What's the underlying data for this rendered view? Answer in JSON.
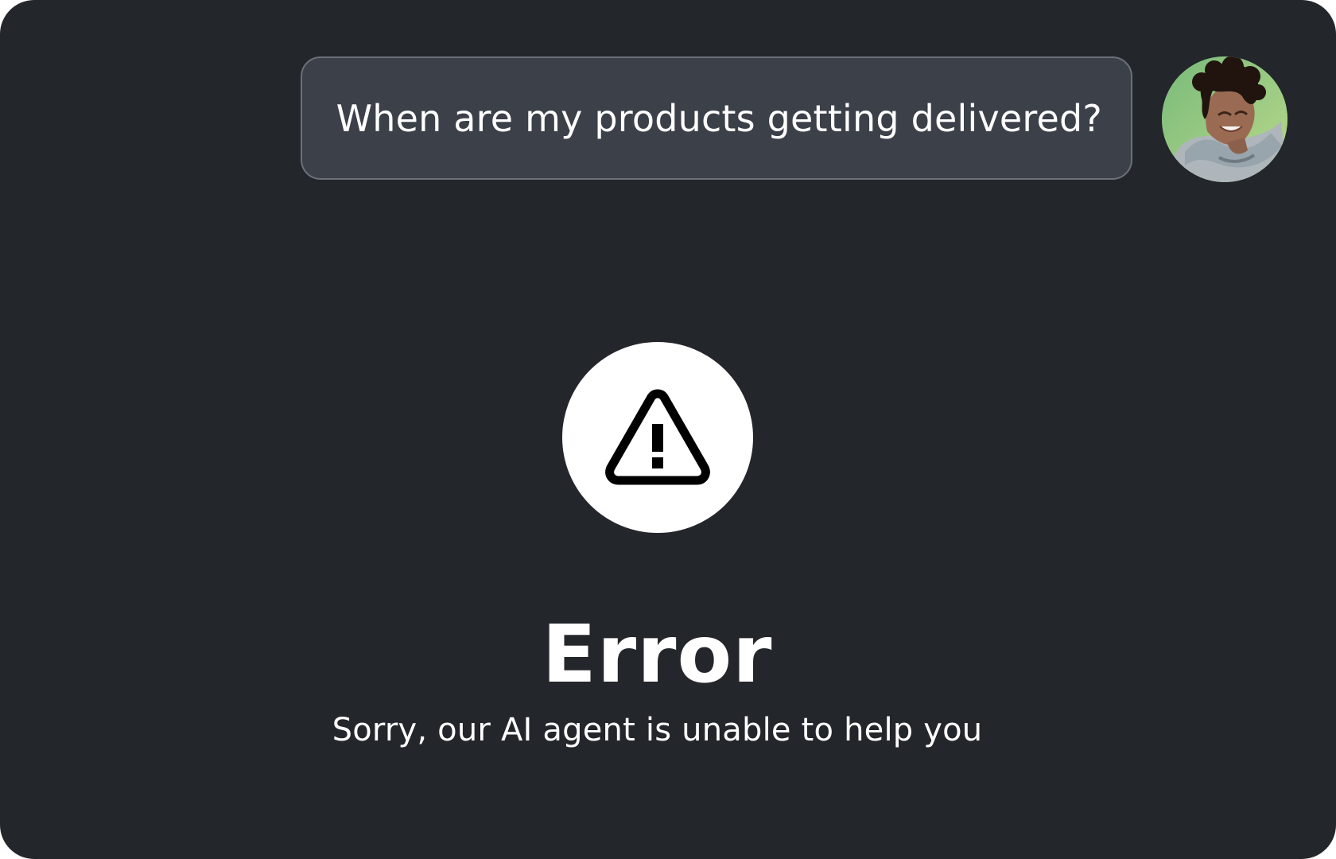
{
  "chat": {
    "user_message": "When are my products getting delivered?",
    "avatar_icon": "user-avatar-icon"
  },
  "error": {
    "icon": "warning-triangle-icon",
    "title": "Error",
    "message": "Sorry, our AI agent is unable to help you"
  },
  "colors": {
    "background": "#23262b",
    "bubble": "#3c4049",
    "bubble_border": "#6b7079",
    "text": "#ffffff",
    "warning_circle": "#ffffff",
    "warning_icon": "#000000"
  }
}
